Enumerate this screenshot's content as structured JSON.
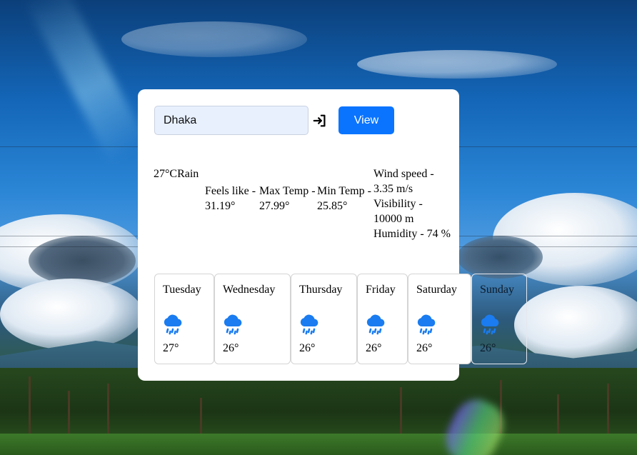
{
  "search": {
    "value": "Dhaka",
    "button_label": "View"
  },
  "current": {
    "temperature": "27°C",
    "condition": "Rain",
    "feels_like": "Feels like - 31.19°",
    "max_temp": "Max Temp - 27.99°",
    "min_temp": "Min Temp - 25.85°",
    "wind_speed": "Wind speed - 3.35 m/s",
    "visibility": "Visibility - 10000 m",
    "humidity": "Humidity - 74 %"
  },
  "forecast": [
    {
      "day": "Tuesday",
      "temp": "27°",
      "icon": "cloud-rain-icon"
    },
    {
      "day": "Wednesday",
      "temp": "26°",
      "icon": "cloud-rain-icon"
    },
    {
      "day": "Thursday",
      "temp": "26°",
      "icon": "cloud-rain-icon"
    },
    {
      "day": "Friday",
      "temp": "26°",
      "icon": "cloud-rain-icon"
    },
    {
      "day": "Saturday",
      "temp": "26°",
      "icon": "cloud-rain-icon"
    },
    {
      "day": "Sunday",
      "temp": "26°",
      "icon": "cloud-rain-icon"
    }
  ],
  "colors": {
    "accent": "#0b74ff",
    "icon": "#1a7cf0",
    "input_bg": "#e8f0fe"
  }
}
